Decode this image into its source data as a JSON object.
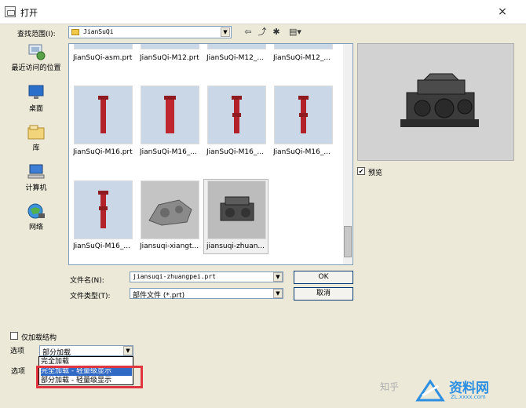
{
  "window": {
    "title": "打开",
    "close_glyph": "×"
  },
  "toolbar": {
    "look_in_label": "查找范围(I):",
    "look_in_value": "JianSuQi",
    "back_glyph": "⇦",
    "up_glyph": "⤴",
    "new_folder_glyph": "✱",
    "view_glyph": "▤▾"
  },
  "places": [
    {
      "label": "最近访问的位置",
      "icon": "recent-places-icon"
    },
    {
      "label": "桌面",
      "icon": "desktop-icon"
    },
    {
      "label": "库",
      "icon": "library-icon"
    },
    {
      "label": "计算机",
      "icon": "computer-icon"
    },
    {
      "label": "网络",
      "icon": "network-icon"
    }
  ],
  "files": {
    "row1": [
      "JianSuQi-asm.prt",
      "JianSuQi-M12.prt",
      "JianSuQi-M12_...",
      "JianSuQi-M12_..."
    ],
    "row2": [
      "JianSuQi-M16.prt",
      "JianSuQi-M16_...",
      "JianSuQi-M16_...",
      "JianSuQi-M16_..."
    ],
    "row3": [
      "JianSuQi-M16_...",
      "Jiansuqi-xiangt...",
      "jiansuqi-zhuan..."
    ],
    "selected": "jiansuqi-zhuan..."
  },
  "preview": {
    "checked": true,
    "label": "预览",
    "check_glyph": "✔"
  },
  "filename": {
    "label": "文件名(N):",
    "value": "jiansuqi-zhuangpei.prt"
  },
  "filetype": {
    "label": "文件类型(T):",
    "value": "部件文件 (*.prt)"
  },
  "buttons": {
    "ok": "OK",
    "cancel": "取消"
  },
  "load_structure": {
    "label": "仅加载结构",
    "checked": false
  },
  "options": {
    "label1": "选项",
    "label2": "选项",
    "selected": "部分加载",
    "dropdown_items": [
      "完全加载",
      "完全加载 - 轻量级显示",
      "部分加载 - 轻量级显示"
    ],
    "highlighted_index": 1
  },
  "watermark": {
    "zhihu": "知乎",
    "site": "资料网",
    "url": "ZL.xxxx.com"
  },
  "colors": {
    "accent": "#316ac5",
    "annotation_box": "#e0343f",
    "thumb_bg": "#c9d7e6",
    "part_red": "#b3222a"
  }
}
